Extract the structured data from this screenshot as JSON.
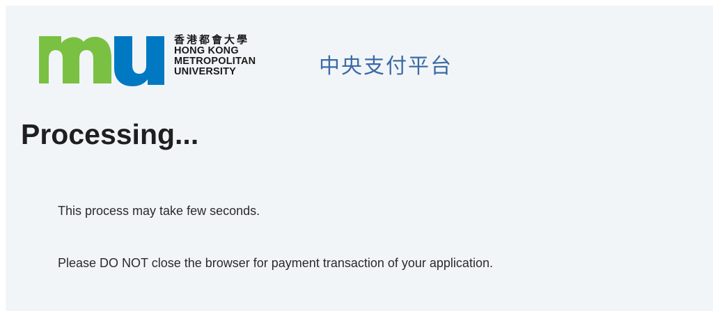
{
  "brand": {
    "name_zh": "香港都會大學",
    "name_en_lines": [
      "HONG KONG",
      "METROPOLITAN",
      "UNIVERSITY"
    ],
    "logo_icon": "mu-logo-icon",
    "colors": {
      "green": "#7ac143",
      "blue": "#0079c2"
    }
  },
  "header": {
    "site_title": "中央支付平台"
  },
  "main": {
    "heading": "Processing...",
    "messages": [
      "This process may take few seconds.",
      "Please DO NOT close the browser for payment transaction of your application."
    ]
  }
}
